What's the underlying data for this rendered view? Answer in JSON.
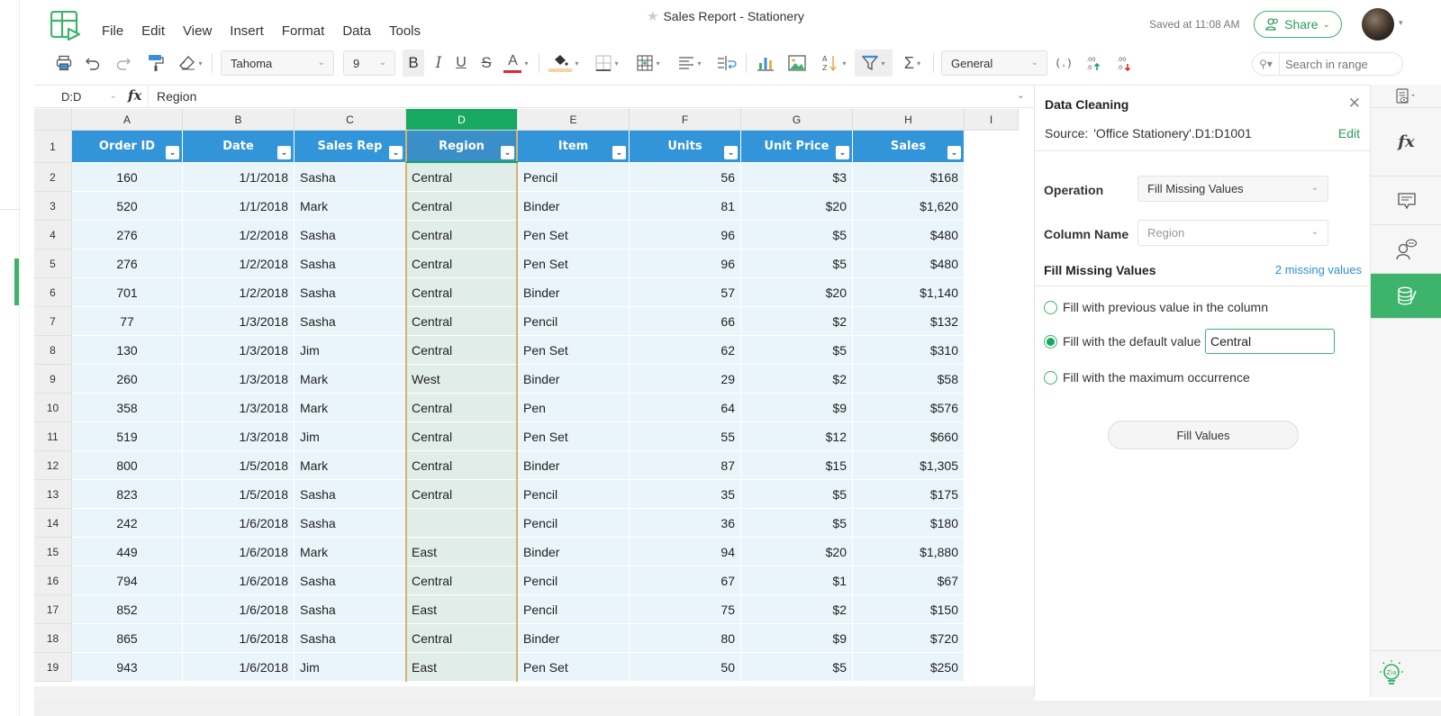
{
  "header": {
    "doc_title": "Sales Report - Stationery",
    "saved_status": "Saved at 11:08 AM",
    "share_label": "Share",
    "menu": [
      "File",
      "Edit",
      "View",
      "Insert",
      "Format",
      "Data",
      "Tools"
    ]
  },
  "toolbar": {
    "font_name": "Tahoma",
    "font_size": "9",
    "number_format": "General",
    "search_placeholder": "Search in range",
    "icons": [
      "print-icon",
      "undo-icon",
      "redo-icon",
      "paint-format-icon",
      "clear-format-icon",
      "bold-icon",
      "italic-icon",
      "underline-icon",
      "strikethrough-icon",
      "font-color-icon",
      "fill-color-icon",
      "borders-icon",
      "merge-cells-icon",
      "align-icon",
      "wrap-text-icon",
      "chart-icon",
      "image-icon",
      "sort-icon",
      "filter-icon",
      "sum-icon",
      "comma-style-icon",
      "increase-decimal-icon",
      "decrease-decimal-icon"
    ],
    "bold_glyph": "B",
    "italic_glyph": "I",
    "underline_glyph": "U",
    "strike_glyph": "S",
    "fontcolor_glyph": "A",
    "sum_glyph": "Σ",
    "comma_glyph": "( , )",
    "accent_font_color": "#e0282e",
    "accent_fill_color": "#f3d7a3"
  },
  "formula_bar": {
    "name_box": "D:D",
    "fx_label": "fx",
    "content": "Region"
  },
  "sheet": {
    "column_letters": [
      "A",
      "B",
      "C",
      "D",
      "E",
      "F",
      "G",
      "H",
      "I"
    ],
    "selected_column": "D",
    "headers": [
      "Order ID",
      "Date",
      "Sales Rep",
      "Region",
      "Item",
      "Units",
      "Unit Price",
      "Sales"
    ],
    "rows": [
      {
        "n": "2",
        "cells": [
          "160",
          "1/1/2018",
          "Sasha",
          "Central",
          "Pencil",
          "56",
          "$3",
          "$168"
        ]
      },
      {
        "n": "3",
        "cells": [
          "520",
          "1/1/2018",
          "Mark",
          "Central",
          "Binder",
          "81",
          "$20",
          "$1,620"
        ]
      },
      {
        "n": "4",
        "cells": [
          "276",
          "1/2/2018",
          "Sasha",
          "Central",
          "Pen Set",
          "96",
          "$5",
          "$480"
        ]
      },
      {
        "n": "5",
        "cells": [
          "276",
          "1/2/2018",
          "Sasha",
          "Central",
          "Pen Set",
          "96",
          "$5",
          "$480"
        ]
      },
      {
        "n": "6",
        "cells": [
          "701",
          "1/2/2018",
          "Sasha",
          "Central",
          "Binder",
          "57",
          "$20",
          "$1,140"
        ]
      },
      {
        "n": "7",
        "cells": [
          "77",
          "1/3/2018",
          "Sasha",
          "Central",
          "Pencil",
          "66",
          "$2",
          "$132"
        ]
      },
      {
        "n": "8",
        "cells": [
          "130",
          "1/3/2018",
          "Jim",
          "Central",
          "Pen Set",
          "62",
          "$5",
          "$310"
        ]
      },
      {
        "n": "9",
        "cells": [
          "260",
          "1/3/2018",
          "Mark",
          "West",
          "Binder",
          "29",
          "$2",
          "$58"
        ]
      },
      {
        "n": "10",
        "cells": [
          "358",
          "1/3/2018",
          "Mark",
          "Central",
          "Pen",
          "64",
          "$9",
          "$576"
        ]
      },
      {
        "n": "11",
        "cells": [
          "519",
          "1/3/2018",
          "Jim",
          "Central",
          "Pen Set",
          "55",
          "$12",
          "$660"
        ]
      },
      {
        "n": "12",
        "cells": [
          "800",
          "1/5/2018",
          "Mark",
          "Central",
          "Binder",
          "87",
          "$15",
          "$1,305"
        ]
      },
      {
        "n": "13",
        "cells": [
          "823",
          "1/5/2018",
          "Sasha",
          "Central",
          "Pencil",
          "35",
          "$5",
          "$175"
        ]
      },
      {
        "n": "14",
        "cells": [
          "242",
          "1/6/2018",
          "Sasha",
          "",
          "Pencil",
          "36",
          "$5",
          "$180"
        ]
      },
      {
        "n": "15",
        "cells": [
          "449",
          "1/6/2018",
          "Mark",
          "East",
          "Binder",
          "94",
          "$20",
          "$1,880"
        ]
      },
      {
        "n": "16",
        "cells": [
          "794",
          "1/6/2018",
          "Sasha",
          "Central",
          "Pencil",
          "67",
          "$1",
          "$67"
        ]
      },
      {
        "n": "17",
        "cells": [
          "852",
          "1/6/2018",
          "Sasha",
          "East",
          "Pencil",
          "75",
          "$2",
          "$150"
        ]
      },
      {
        "n": "18",
        "cells": [
          "865",
          "1/6/2018",
          "Sasha",
          "Central",
          "Binder",
          "80",
          "$9",
          "$720"
        ]
      },
      {
        "n": "19",
        "cells": [
          "943",
          "1/6/2018",
          "Jim",
          "East",
          "Pen Set",
          "50",
          "$5",
          "$250"
        ]
      }
    ],
    "header_color": "#3294d9",
    "row_color": "#eaf5fb",
    "selected_col_color": "#e1ede9"
  },
  "panel": {
    "title": "Data Cleaning",
    "source_label": "Source:",
    "source_value": "'Office Stationery'.D1:D1001",
    "edit_label": "Edit",
    "operation_label": "Operation",
    "operation_value": "Fill Missing Values",
    "column_label": "Column Name",
    "column_value": "Region",
    "section_title": "Fill Missing Values",
    "missing_count": "2 missing values",
    "options": [
      {
        "label": "Fill with previous value in the column",
        "selected": false
      },
      {
        "label": "Fill with the default value",
        "selected": true
      },
      {
        "label": "Fill with the maximum occurrence",
        "selected": false
      }
    ],
    "default_value": "Central",
    "fill_button": "Fill Values"
  },
  "iconbar": {
    "items": [
      "sheet-view-icon",
      "functions-icon",
      "comments-icon",
      "collaborators-icon",
      "data-cleaning-icon"
    ],
    "active": "data-cleaning-icon",
    "fx_glyph": "fx",
    "bulb_label": "Zia"
  },
  "colors": {
    "brand_green": "#3db36b",
    "active_col_green": "#17a862",
    "link_blue": "#2f8ed8"
  }
}
